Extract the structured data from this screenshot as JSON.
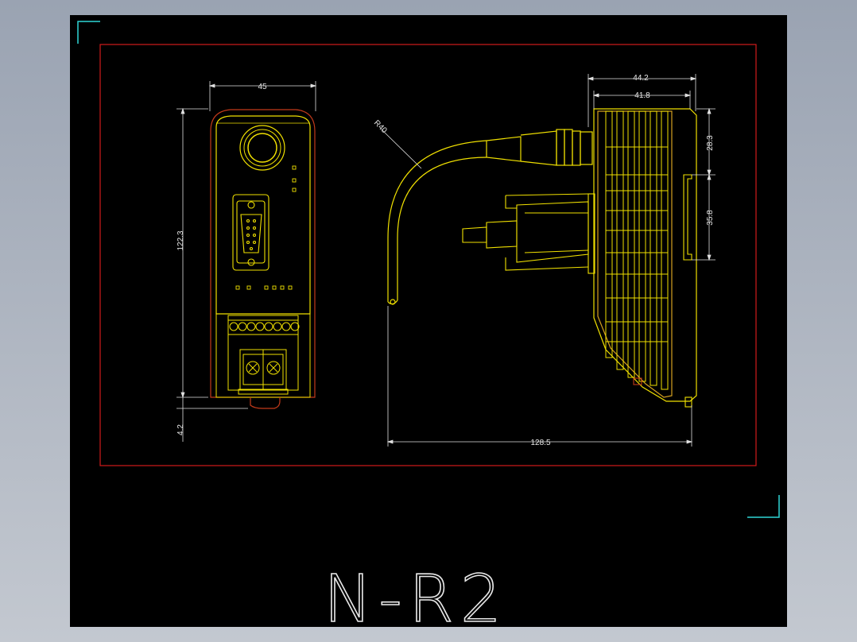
{
  "drawing": {
    "title": "N-R2",
    "colors": {
      "background": "#000000",
      "border": "#d21a1a",
      "outline_primary": "#f0e000",
      "outline_secondary": "#d4a020",
      "dimension": "#e0e0e0",
      "corner_mark": "#2fd6d6",
      "title": "#e8e8e8"
    }
  },
  "front_view": {
    "width_dim": "45",
    "height_dim": "122.3",
    "bottom_dim": "4.2"
  },
  "side_view": {
    "radius_dim": "R40",
    "top_dim_outer": "44.2",
    "top_dim_inner": "41.8",
    "right_dim_upper": "28.3",
    "right_dim_lower": "35.8",
    "bottom_dim": "128.5"
  }
}
